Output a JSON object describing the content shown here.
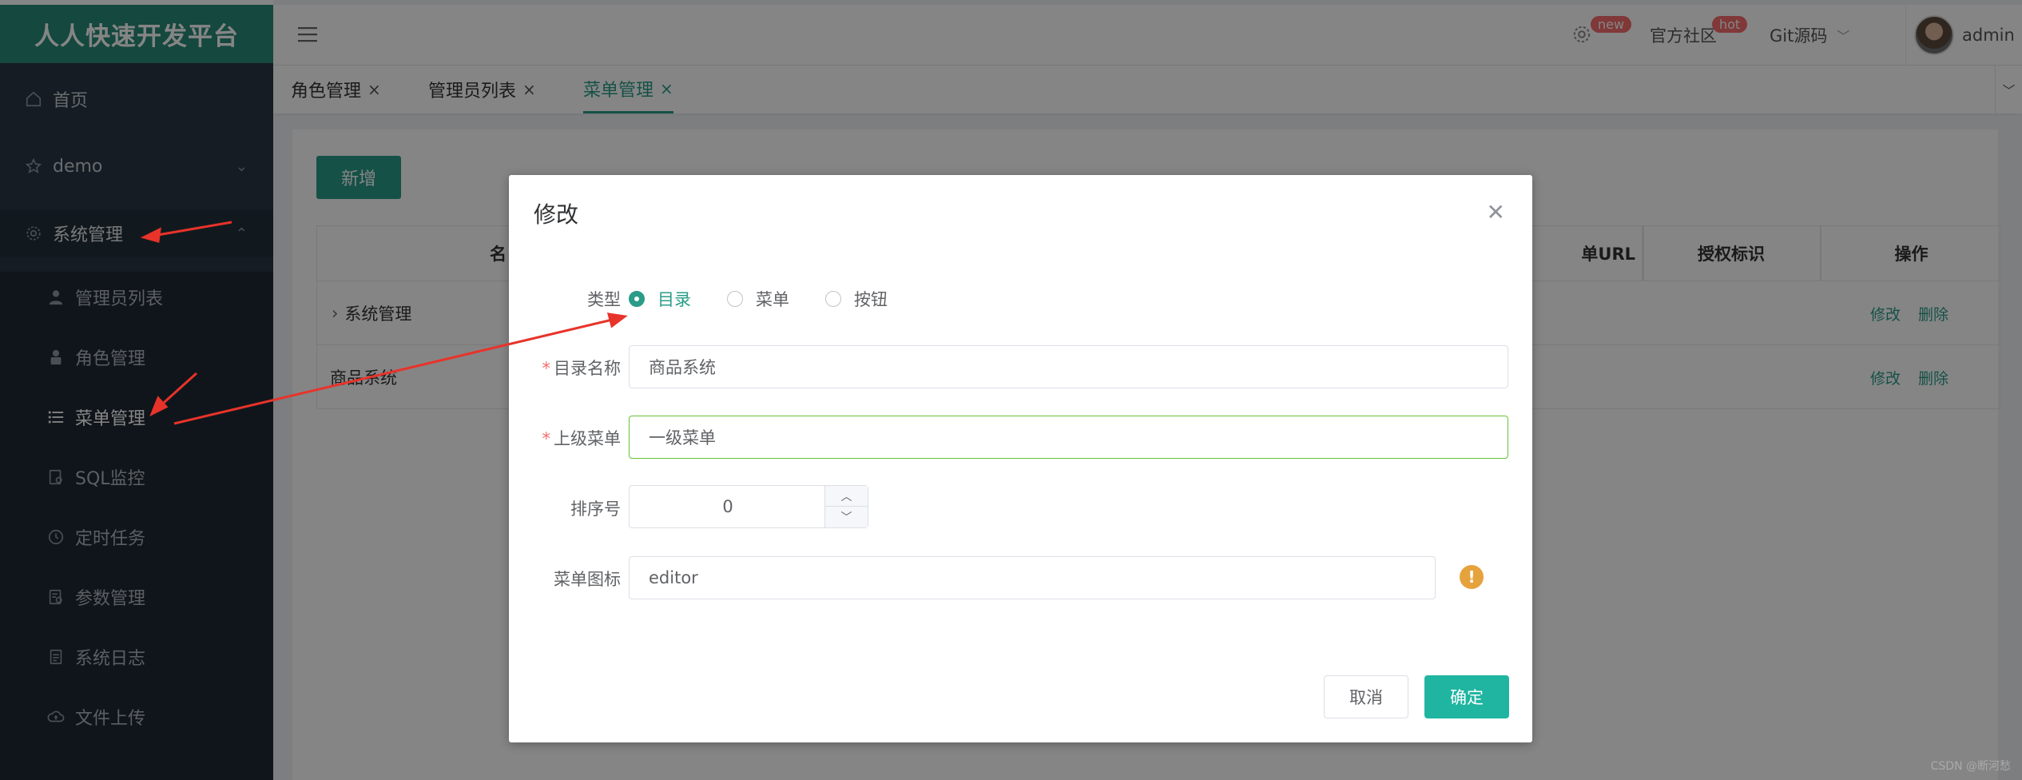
{
  "app": {
    "title": "人人快速开发平台"
  },
  "sidebar": {
    "items": [
      {
        "label": "首页",
        "icon": "home-icon"
      },
      {
        "label": "demo",
        "icon": "star-icon"
      },
      {
        "label": "系统管理",
        "icon": "gear-icon"
      }
    ],
    "subitems": [
      {
        "label": "管理员列表",
        "icon": "user-icon"
      },
      {
        "label": "角色管理",
        "icon": "role-icon"
      },
      {
        "label": "菜单管理",
        "icon": "list-icon"
      },
      {
        "label": "SQL监控",
        "icon": "sql-icon"
      },
      {
        "label": "定时任务",
        "icon": "clock-icon"
      },
      {
        "label": "参数管理",
        "icon": "param-icon"
      },
      {
        "label": "系统日志",
        "icon": "log-icon"
      },
      {
        "label": "文件上传",
        "icon": "cloud-upload-icon"
      }
    ]
  },
  "header": {
    "badge_new": "new",
    "community": "官方社区",
    "badge_hot": "hot",
    "git": "Git源码",
    "user": "admin"
  },
  "tabs": [
    {
      "label": "角色管理"
    },
    {
      "label": "管理员列表"
    },
    {
      "label": "菜单管理"
    }
  ],
  "toolbar": {
    "add_label": "新增"
  },
  "table": {
    "columns": [
      "名",
      "单URL",
      "授权标识",
      "操作"
    ],
    "rows": [
      {
        "name": "系统管理"
      },
      {
        "name": "商品系统"
      }
    ],
    "edit_label": "修改",
    "delete_label": "删除"
  },
  "dialog": {
    "title": "修改",
    "type_label": "类型",
    "type_options": [
      "目录",
      "菜单",
      "按钮"
    ],
    "type_selected": "目录",
    "name_label": "目录名称",
    "name_value": "商品系统",
    "parent_label": "上级菜单",
    "parent_value": "一级菜单",
    "order_label": "排序号",
    "order_value": "0",
    "icon_label": "菜单图标",
    "icon_value": "editor",
    "cancel_label": "取消",
    "ok_label": "确定"
  },
  "watermark": "CSDN @断河愁",
  "colors": {
    "brand": "#2a9c88",
    "sidebar": "#293743",
    "danger": "#f56c6c",
    "warning": "#e6a23c"
  }
}
